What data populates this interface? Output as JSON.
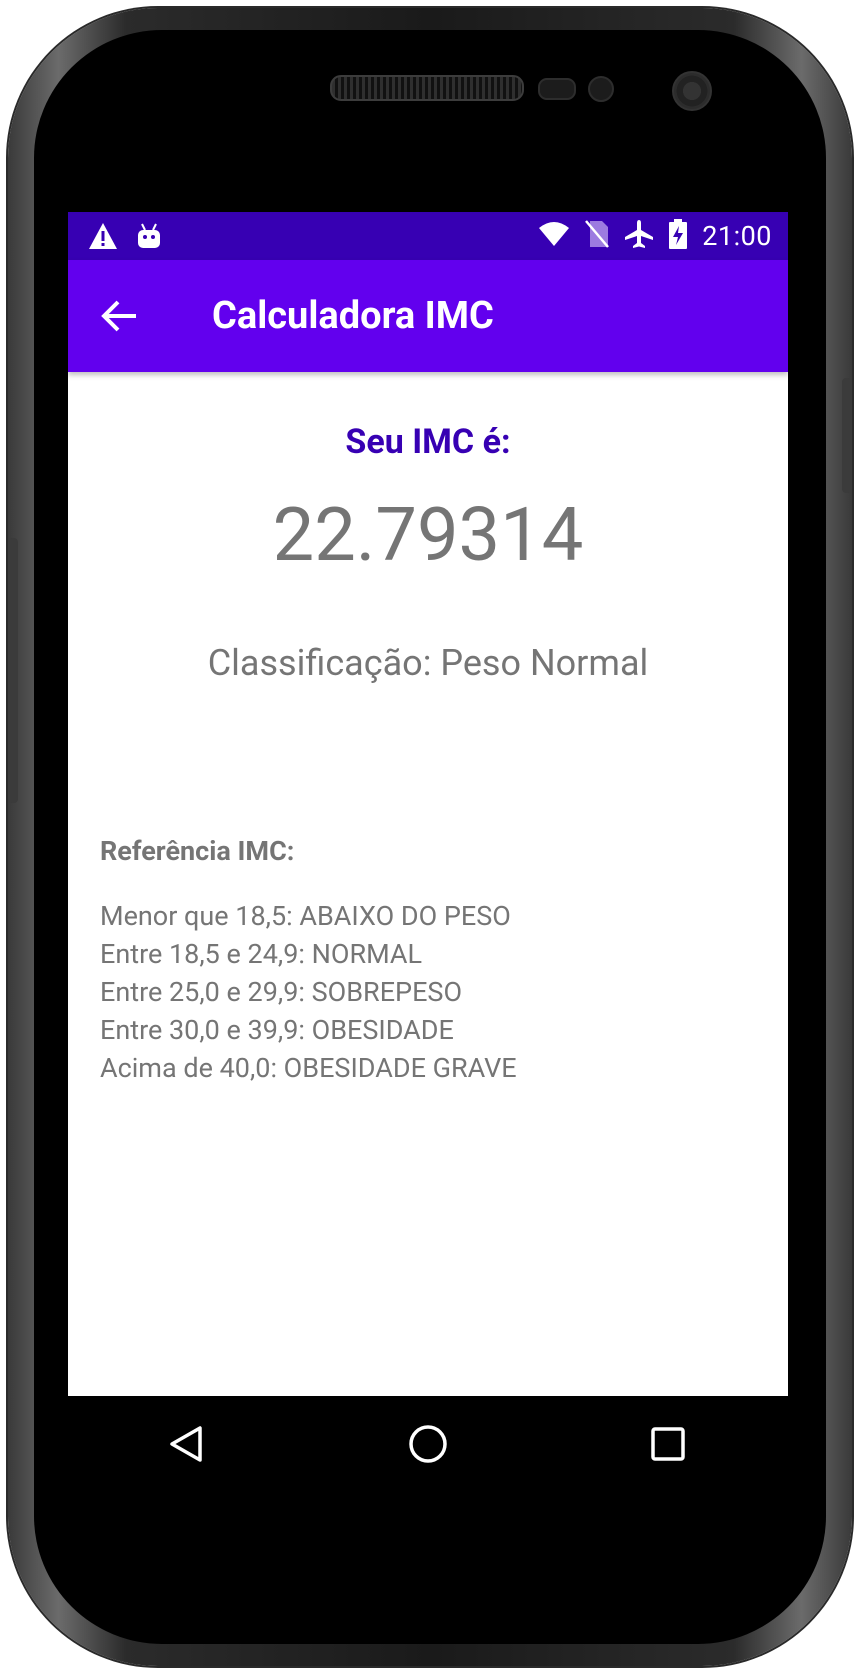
{
  "status_bar": {
    "time": "21:00",
    "icons": [
      "warning-icon",
      "android-debug-icon",
      "wifi-icon",
      "no-sim-icon",
      "airplane-icon",
      "battery-charging-icon"
    ]
  },
  "app_bar": {
    "title": "Calculadora IMC",
    "back_icon": "arrow-back-icon",
    "color": "#6200ee"
  },
  "result": {
    "heading": "Seu IMC é:",
    "value": "22.79314",
    "classification": "Classificação: Peso Normal"
  },
  "reference": {
    "title": "Referência IMC:",
    "lines": [
      "Menor que 18,5: ABAIXO DO PESO",
      "Entre 18,5 e 24,9: NORMAL",
      "Entre 25,0 e 29,9: SOBREPESO",
      "Entre 30,0 e 39,9: OBESIDADE",
      "Acima de 40,0: OBESIDADE GRAVE"
    ]
  },
  "nav_bar": {
    "buttons": [
      "back-triangle-icon",
      "home-circle-icon",
      "recents-square-icon"
    ]
  },
  "colors": {
    "status_bar": "#3700b3",
    "primary": "#6200ee",
    "heading": "#3700b3",
    "text": "#757575"
  }
}
